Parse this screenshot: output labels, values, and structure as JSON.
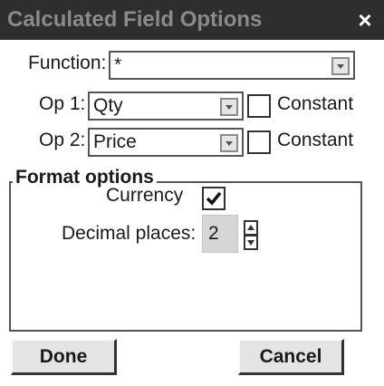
{
  "dialog": {
    "title": "Calculated Field Options",
    "close_glyph": "×"
  },
  "function_row": {
    "label": "Function:",
    "value": "*"
  },
  "op1_row": {
    "label": "Op 1:",
    "value": "Qty",
    "constant_label": "Constant",
    "constant_checked": false
  },
  "op2_row": {
    "label": "Op 2:",
    "value": "Price",
    "constant_label": "Constant",
    "constant_checked": false
  },
  "format_options": {
    "legend": "Format options",
    "currency_label": "Currency",
    "currency_checked": true,
    "decimal_label": "Decimal places:",
    "decimal_value": "2"
  },
  "buttons": {
    "done": "Done",
    "cancel": "Cancel"
  },
  "colors": {
    "titlebar_bg": "#2e2e2e",
    "title_text": "#8a8a8a",
    "close_text": "#ffffff",
    "button_face": "#e4e4e4",
    "spin_value_bg": "#d6d6d6"
  },
  "icons": {
    "close": "close-icon",
    "dropdown": "chevron-down-icon",
    "check": "checkmark-icon",
    "spin_up": "arrow-up-icon",
    "spin_down": "arrow-down-icon"
  }
}
